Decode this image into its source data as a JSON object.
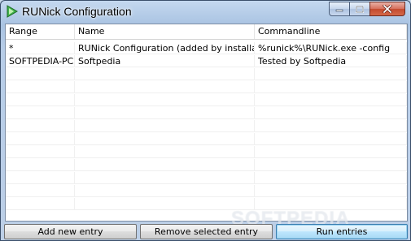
{
  "window": {
    "title": "RUNick Configuration"
  },
  "caption_buttons": {
    "minimize": "minimize-icon",
    "maximize": "maximize-icon",
    "close": "close-icon"
  },
  "table": {
    "columns": [
      "Range",
      "Name",
      "Commandline"
    ],
    "rows": [
      [
        "*",
        "RUNick Configuration (added by installation)",
        "%runick%\\RUNick.exe -config"
      ],
      [
        "SOFTPEDIA-PC",
        "Softpedia",
        "Tested by Softpedia"
      ]
    ]
  },
  "buttons": {
    "add": "Add new entry",
    "remove": "Remove selected entry",
    "run": "Run entries"
  },
  "watermark": "SOFTPEDIA",
  "colors": {
    "titlebar": "#a9c3e2",
    "close_button": "#c44a2f",
    "grid_background": "#ffffff"
  }
}
